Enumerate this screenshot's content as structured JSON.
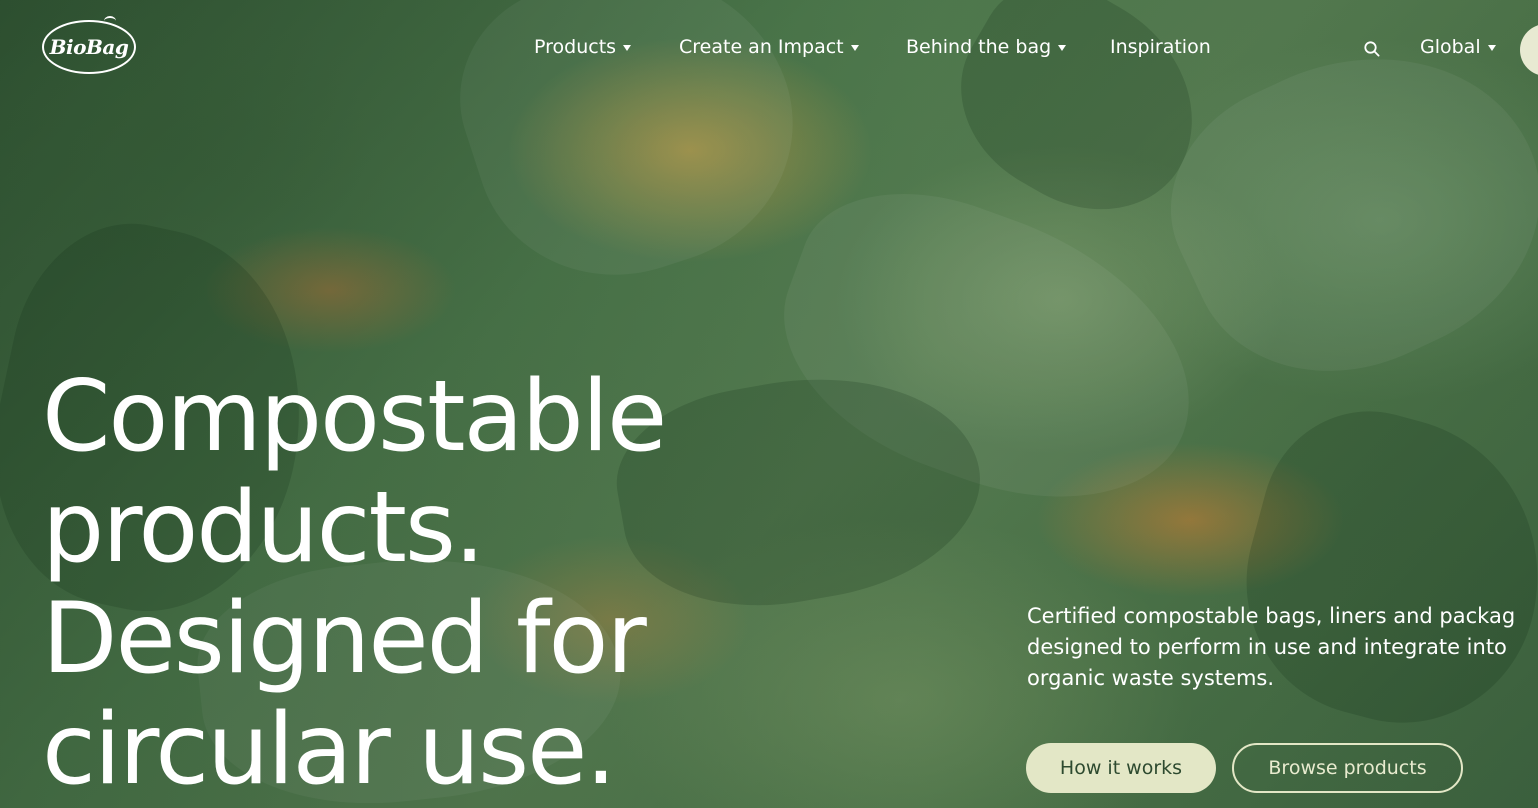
{
  "brand": {
    "logo_text": "BioBag"
  },
  "nav": {
    "items": [
      {
        "label": "Products",
        "has_dropdown": true
      },
      {
        "label": "Create an Impact",
        "has_dropdown": true
      },
      {
        "label": "Behind the bag",
        "has_dropdown": true
      },
      {
        "label": "Inspiration",
        "has_dropdown": false
      }
    ],
    "search_icon": "search-icon",
    "region": {
      "label": "Global",
      "has_dropdown": true
    }
  },
  "hero": {
    "headline_lines": [
      "Compostable",
      "products.",
      "Designed for",
      "circular use."
    ],
    "subtext_lines": [
      "Certified compostable bags, liners and packag",
      "designed to perform in use and integrate into",
      "organic waste systems."
    ],
    "primary_button": "How it works",
    "secondary_button": "Browse products"
  },
  "colors": {
    "button_fill": "#e3e7c6",
    "button_text": "#2d4a2f",
    "background_green": "#4e7a4d"
  }
}
